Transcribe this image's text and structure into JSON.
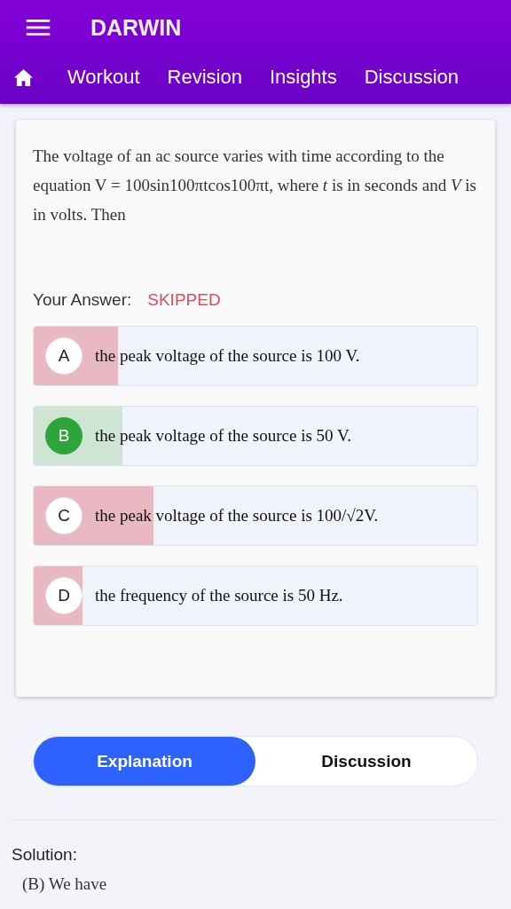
{
  "app_bar": {
    "title": "DARWIN"
  },
  "nav_tabs": [
    "Workout",
    "Revision",
    "Insights",
    "Discussion"
  ],
  "question": {
    "text": "The voltage of an ac source varies with time according to the equation V = 100sin100πtcos100πt, where *t* is in seconds and *V* is in volts. Then",
    "answer_label": "Your Answer:",
    "answer_value": "SKIPPED",
    "options": [
      {
        "letter": "A",
        "text": "the peak voltage of the source is 100 V.",
        "correct": false,
        "level": 0.19
      },
      {
        "letter": "B",
        "text": "the peak voltage of the source is 50 V.",
        "correct": true,
        "level": 0.2
      },
      {
        "letter": "C",
        "text": "the peak voltage of the source is 100/√2V.",
        "correct": false,
        "level": 0.27
      },
      {
        "letter": "D",
        "text": "the frequency of the source is 50 Hz.",
        "correct": false,
        "level": 0.11
      }
    ]
  },
  "segments": [
    {
      "label": "Explanation",
      "selected": true
    },
    {
      "label": "Discussion",
      "selected": false
    }
  ],
  "solution": {
    "heading": "Solution:",
    "text": "(B) We have"
  }
}
